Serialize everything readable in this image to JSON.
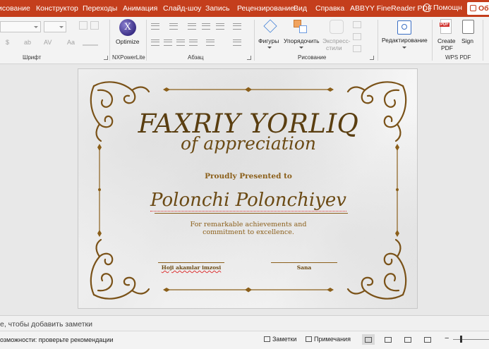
{
  "ribbon_tabs": [
    {
      "label": "исование"
    },
    {
      "label": "Конструктор"
    },
    {
      "label": "Переходы"
    },
    {
      "label": "Анимация"
    },
    {
      "label": "Слайд-шоу"
    },
    {
      "label": "Запись"
    },
    {
      "label": "Рецензирование"
    },
    {
      "label": "Вид"
    },
    {
      "label": "Справка"
    },
    {
      "label": "ABBYY FineReader PDF"
    }
  ],
  "help": {
    "label": "Помощн"
  },
  "share": {
    "label": "Об"
  },
  "groups": {
    "font": "Шрифт",
    "nxpowerlite": "NXPowerLite",
    "paragraph": "Абзац",
    "drawing": "Рисование",
    "wps_pdf": "WPS PDF"
  },
  "commands": {
    "optimize": "Optimize",
    "shapes": "Фигуры",
    "arrange": "Упорядочить",
    "quick_styles_1": "Экспресс-",
    "quick_styles_2": "стили",
    "editing": "Редактирование",
    "create_pdf_1": "Create",
    "create_pdf_2": "PDF",
    "sign": "Sign",
    "font_ghost_1": "$",
    "font_ghost_2": "ab",
    "font_ghost_3": "AV",
    "font_ghost_4": "Aa"
  },
  "slide": {
    "title": "FAXRIY YORLIQ",
    "subtitle": "of appreciation",
    "presented": "Proudly Presented to",
    "recipient": "Polonchi Polonchiyev",
    "reason_line1": "For remarkable achievements and",
    "reason_line2": "commitment to excellence.",
    "signature_left": "Hoji akamlar imzosi",
    "signature_right": "Sana"
  },
  "notes": {
    "placeholder": "е, чтобы добавить заметки"
  },
  "status": {
    "accessibility": "озможности: проверьте рекомендации",
    "notes_btn": "Заметки",
    "comments_btn": "Примечания"
  },
  "colors": {
    "accent": "#c43e1c",
    "gold": "#8b5f1a",
    "brown": "#5a3e10"
  }
}
